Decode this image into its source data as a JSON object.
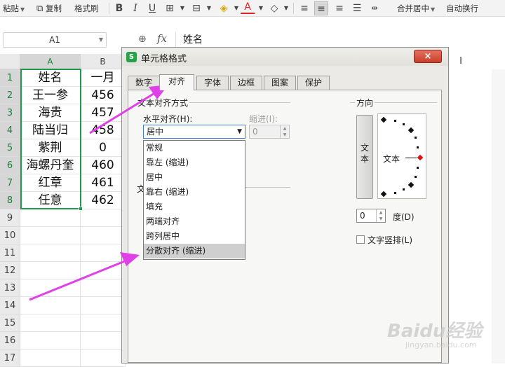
{
  "toolbar": {
    "paste": "粘贴",
    "copy": "复制",
    "format_painter": "格式刷",
    "merge_center": "合并居中",
    "wrap_text": "自动换行"
  },
  "formula_bar": {
    "cell_ref": "A1",
    "fx": "fx",
    "content": "姓名"
  },
  "sheet": {
    "columns": [
      "A",
      "B",
      "I"
    ],
    "rows": [
      "1",
      "2",
      "3",
      "4",
      "5",
      "6",
      "7",
      "8",
      "9",
      "10",
      "11",
      "12",
      "13",
      "14",
      "15",
      "16",
      "17"
    ],
    "col_a": [
      "姓名",
      "王一参",
      "海贵",
      "陆当归",
      "紫荆",
      "海螺丹奎",
      "红章",
      "任意"
    ],
    "col_b": [
      "一月",
      "456",
      "457",
      "458",
      "0",
      "460",
      "461",
      "462"
    ]
  },
  "dialog": {
    "title": "单元格格式",
    "close": "×",
    "tabs": [
      "数字",
      "对齐",
      "字体",
      "边框",
      "图案",
      "保护"
    ],
    "active_tab": "对齐",
    "text_alignment_group": "文本对齐方式",
    "horizontal_label": "水平对齐(H):",
    "horizontal_value": "居中",
    "indent_label": "缩进(I):",
    "indent_value": "0",
    "dropdown_options": [
      "常规",
      "靠左 (缩进)",
      "居中",
      "靠右 (缩进)",
      "填充",
      "两端对齐",
      "跨列居中",
      "分散对齐 (缩进)"
    ],
    "dropdown_highlighted": "分散对齐 (缩进)",
    "orientation_group": "方向",
    "vertical_text": "文本",
    "dial_text": "文本",
    "degree_value": "0",
    "degree_label": "度(D)",
    "vertical_checkbox_label": "文字竖排(L)",
    "hidden_label_fragment": "文"
  },
  "watermark": {
    "logo": "Baidu经验",
    "url": "jingyan.baidu.com"
  },
  "colors": {
    "selection": "#1d9a4a",
    "arrow": "#e040e8",
    "close_button": "#c6402b"
  }
}
